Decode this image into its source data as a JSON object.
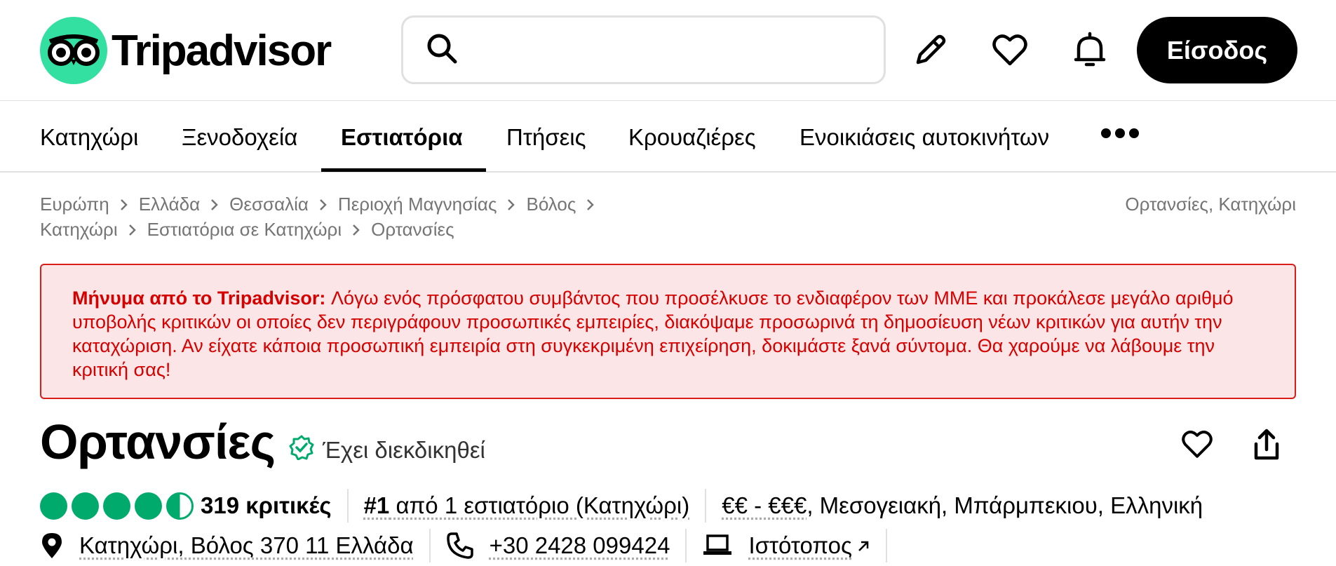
{
  "header": {
    "logo_text": "Tripadvisor",
    "search_placeholder": "",
    "signin_label": "Είσοδος"
  },
  "nav": {
    "items": [
      {
        "label": "Κατηχώρι"
      },
      {
        "label": "Ξενοδοχεία"
      },
      {
        "label": "Εστιατόρια"
      },
      {
        "label": "Πτήσεις"
      },
      {
        "label": "Κρουαζιέρες"
      },
      {
        "label": "Ενοικιάσεις αυτοκινήτων"
      }
    ],
    "active": "Εστιατόρια"
  },
  "breadcrumbs": {
    "line1": [
      "Ευρώπη",
      "Ελλάδα",
      "Θεσσαλία",
      "Περιοχή Μαγνησίας",
      "Βόλος"
    ],
    "line2": [
      "Κατηχώρι",
      "Εστιατόρια σε Κατηχώρι",
      "Ορτανσίες"
    ],
    "right": "Ορτανσίες, Κατηχώρι"
  },
  "alert": {
    "prefix": "Μήνυμα από το Tripadvisor:",
    "message": " Λόγω ενός πρόσφατου συμβάντος που προσέλκυσε το ενδιαφέρον των ΜΜΕ και προκάλεσε μεγάλο αριθμό υποβολής κριτικών οι οποίες δεν περιγράφουν προσωπικές εμπειρίες, διακόψαμε προσωρινά τη δημοσίευση νέων κριτικών για αυτήν την καταχώριση. Αν είχατε κάποια προσωπική εμπειρία στη συγκεκριμένη επιχείρηση, δοκιμάστε ξανά σύντομα. Θα χαρούμε να λάβουμε την κριτική σας!"
  },
  "listing": {
    "name": "Ορτανσίες",
    "claimed": "Έχει διεκδικηθεί",
    "rating": 4.5,
    "reviews": "319 κριτικές",
    "rank_number": "#1",
    "rank_text": " από 1 εστιατόριο (Κατηχώρι)",
    "price": "€€ - €€€",
    "cuisines": ", Μεσογειακή, Μπάρμπεκιου, Ελληνική",
    "address": "Κατηχώρι, Βόλος 370 11 Ελλάδα",
    "phone": "+30 2428 099424",
    "website": "Ιστότοπος"
  },
  "colors": {
    "brand_green": "#34e0a1",
    "rating_green": "#00aa6c",
    "alert_red": "#d50000",
    "alert_bg": "#fbe5e6"
  },
  "icons": [
    "search-icon",
    "pencil-icon",
    "heart-icon",
    "bell-icon",
    "more-dots-icon",
    "verified-icon",
    "share-icon",
    "map-pin-icon",
    "phone-icon",
    "laptop-icon",
    "external-arrow-icon"
  ]
}
